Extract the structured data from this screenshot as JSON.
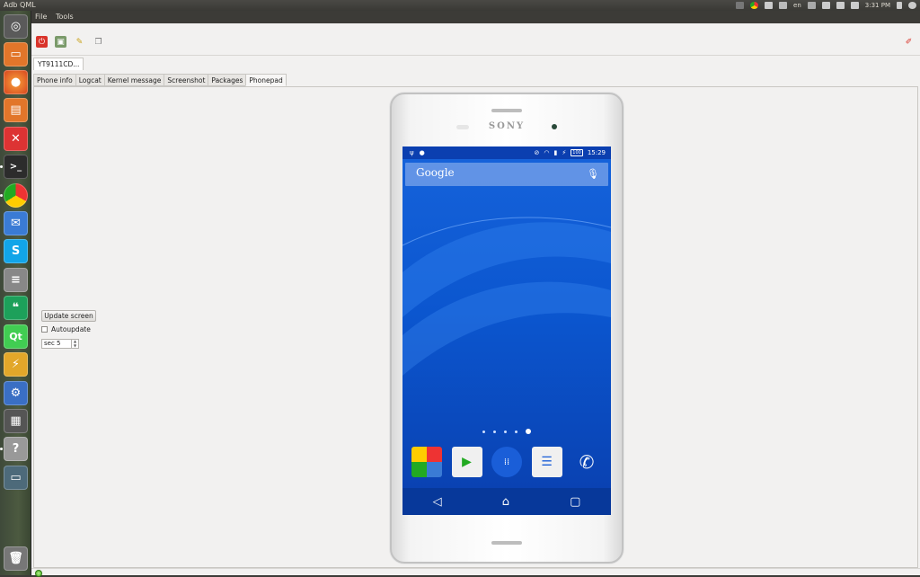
{
  "window": {
    "app_title": "Adb QML"
  },
  "tray": {
    "keyboard": "en",
    "clock": "3:31 PM"
  },
  "menu": {
    "file": "File",
    "tools": "Tools"
  },
  "device_tab": "YT9111CD...",
  "tabs": [
    {
      "label": "Phone info"
    },
    {
      "label": "Logcat"
    },
    {
      "label": "Kernel message"
    },
    {
      "label": "Screenshot"
    },
    {
      "label": "Packages"
    },
    {
      "label": "Phonepad"
    }
  ],
  "phonepad": {
    "update_button": "Update screen",
    "autoupdate_label": "Autoupdate",
    "interval_value": "sec 5"
  },
  "phone": {
    "brand": "SONY",
    "status_time": "15:29",
    "battery": "100",
    "search_label": "Google",
    "page_count": 5,
    "active_page": 5
  },
  "icons": {
    "launcher": [
      "ubuntu-dash-icon",
      "files-icon",
      "firefox-icon",
      "software-center-icon",
      "system-tools-icon",
      "terminal-icon",
      "chrome-icon",
      "thunderbird-icon",
      "skype-icon",
      "storage-icon",
      "hangouts-icon",
      "qt-creator-icon",
      "flash-icon",
      "settings-icon",
      "calculator-icon",
      "help-icon",
      "workspace-icon",
      "trash-icon"
    ],
    "dock": [
      "google-apps-icon",
      "play-store-icon",
      "app-drawer-icon",
      "messaging-icon",
      "phone-dialer-icon"
    ]
  },
  "colors": {
    "screen_blue": "#0a4fc8",
    "accent_red": "#d9342b"
  }
}
